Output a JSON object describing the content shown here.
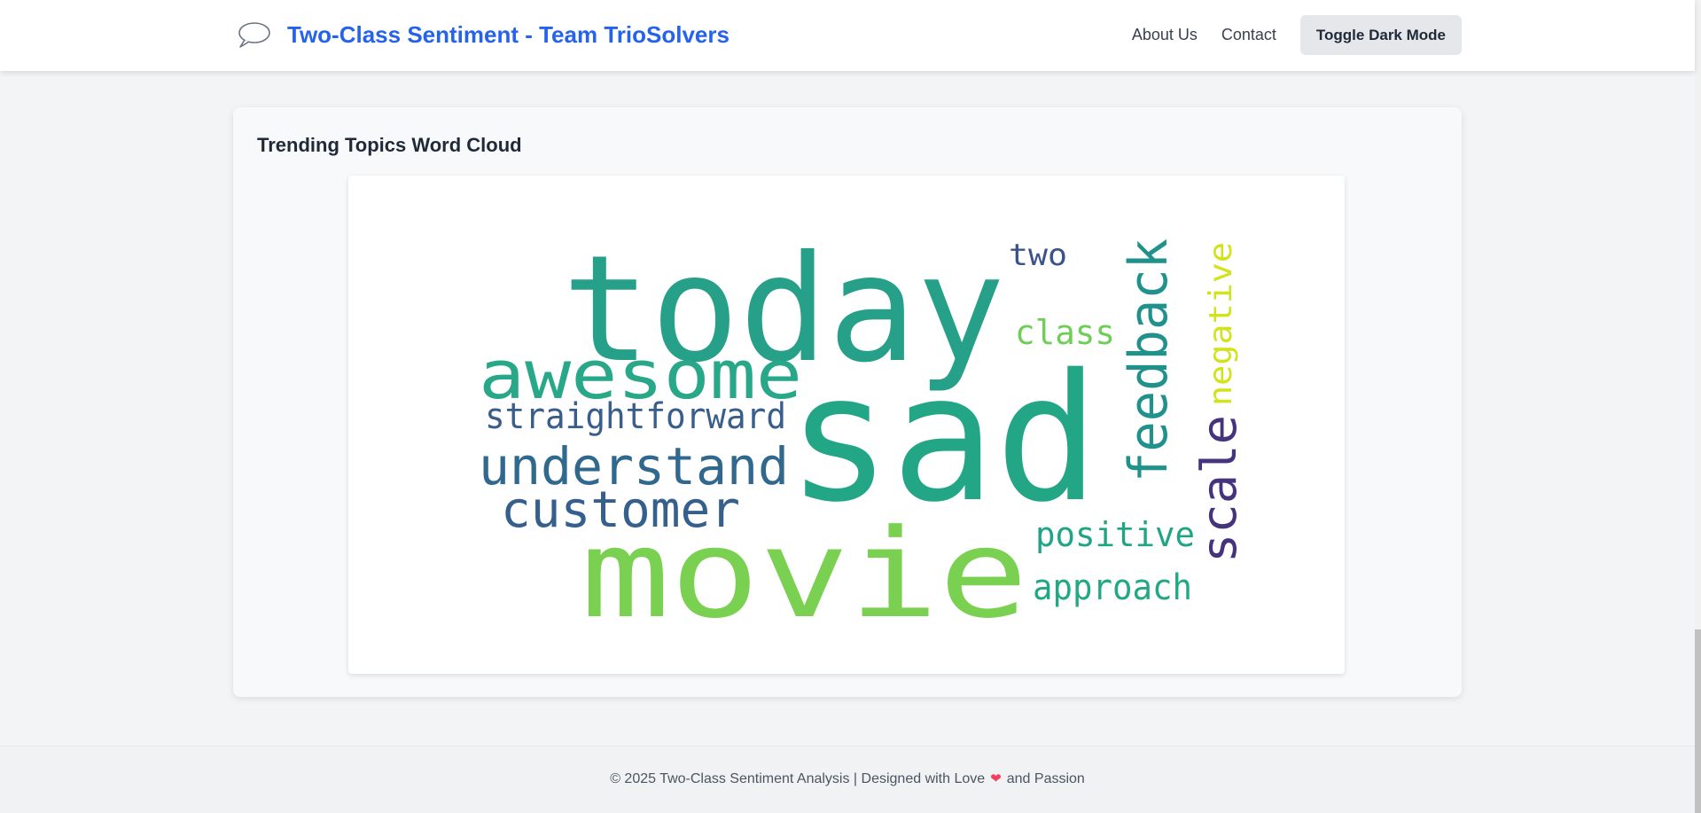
{
  "header": {
    "brand_icon": "speech-bubble-icon",
    "title": "Two-Class Sentiment - Team TrioSolvers",
    "nav": {
      "about_label": "About Us",
      "contact_label": "Contact",
      "toggle_label": "Toggle Dark Mode"
    }
  },
  "card": {
    "title": "Trending Topics Word Cloud",
    "word_cloud": [
      {
        "text": "today",
        "color": "#26a088"
      },
      {
        "text": "sad",
        "color": "#23a685"
      },
      {
        "text": "movie",
        "color": "#7ad151"
      },
      {
        "text": "awesome",
        "color": "#28a888"
      },
      {
        "text": "straightforward",
        "color": "#3a5e8c"
      },
      {
        "text": "understand",
        "color": "#31688e"
      },
      {
        "text": "customer",
        "color": "#355f8d"
      },
      {
        "text": "feedback",
        "color": "#21918c"
      },
      {
        "text": "two",
        "color": "#3b528b"
      },
      {
        "text": "class",
        "color": "#6ece58"
      },
      {
        "text": "negative",
        "color": "#d2e21b"
      },
      {
        "text": "scale",
        "color": "#46337e"
      },
      {
        "text": "positive",
        "color": "#20a486"
      },
      {
        "text": "approach",
        "color": "#22a884"
      }
    ]
  },
  "footer": {
    "text_before": "© 2025 Two-Class Sentiment Analysis | Designed with Love",
    "heart_icon": "heart-icon",
    "text_after": "and Passion"
  },
  "colors": {
    "brand": "#2563eb",
    "page_background": "#f3f4f6"
  }
}
